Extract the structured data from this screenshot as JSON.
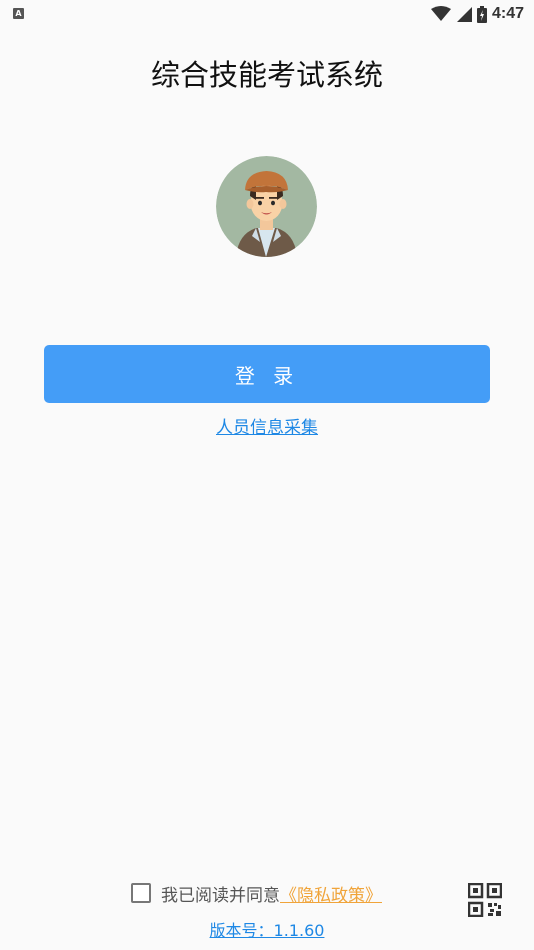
{
  "status_bar": {
    "notification_icon": "A",
    "time": "4:47",
    "icons": [
      "wifi-icon",
      "signal-icon",
      "battery-icon"
    ]
  },
  "app": {
    "title": "综合技能考试系统"
  },
  "avatar": {
    "icon": "user-avatar-illustration"
  },
  "login": {
    "button_label": "登 录",
    "collect_link": "人员信息采集"
  },
  "footer": {
    "agree_text": "我已阅读并同意",
    "privacy_link": "《隐私政策》",
    "checkbox_checked": false,
    "version": "版本号：1.1.60",
    "qr_icon": "qr-code-icon"
  },
  "colors": {
    "primary": "#449df7",
    "link": "#1e88e5",
    "privacy": "#f0a43a",
    "background": "#fafafa"
  }
}
